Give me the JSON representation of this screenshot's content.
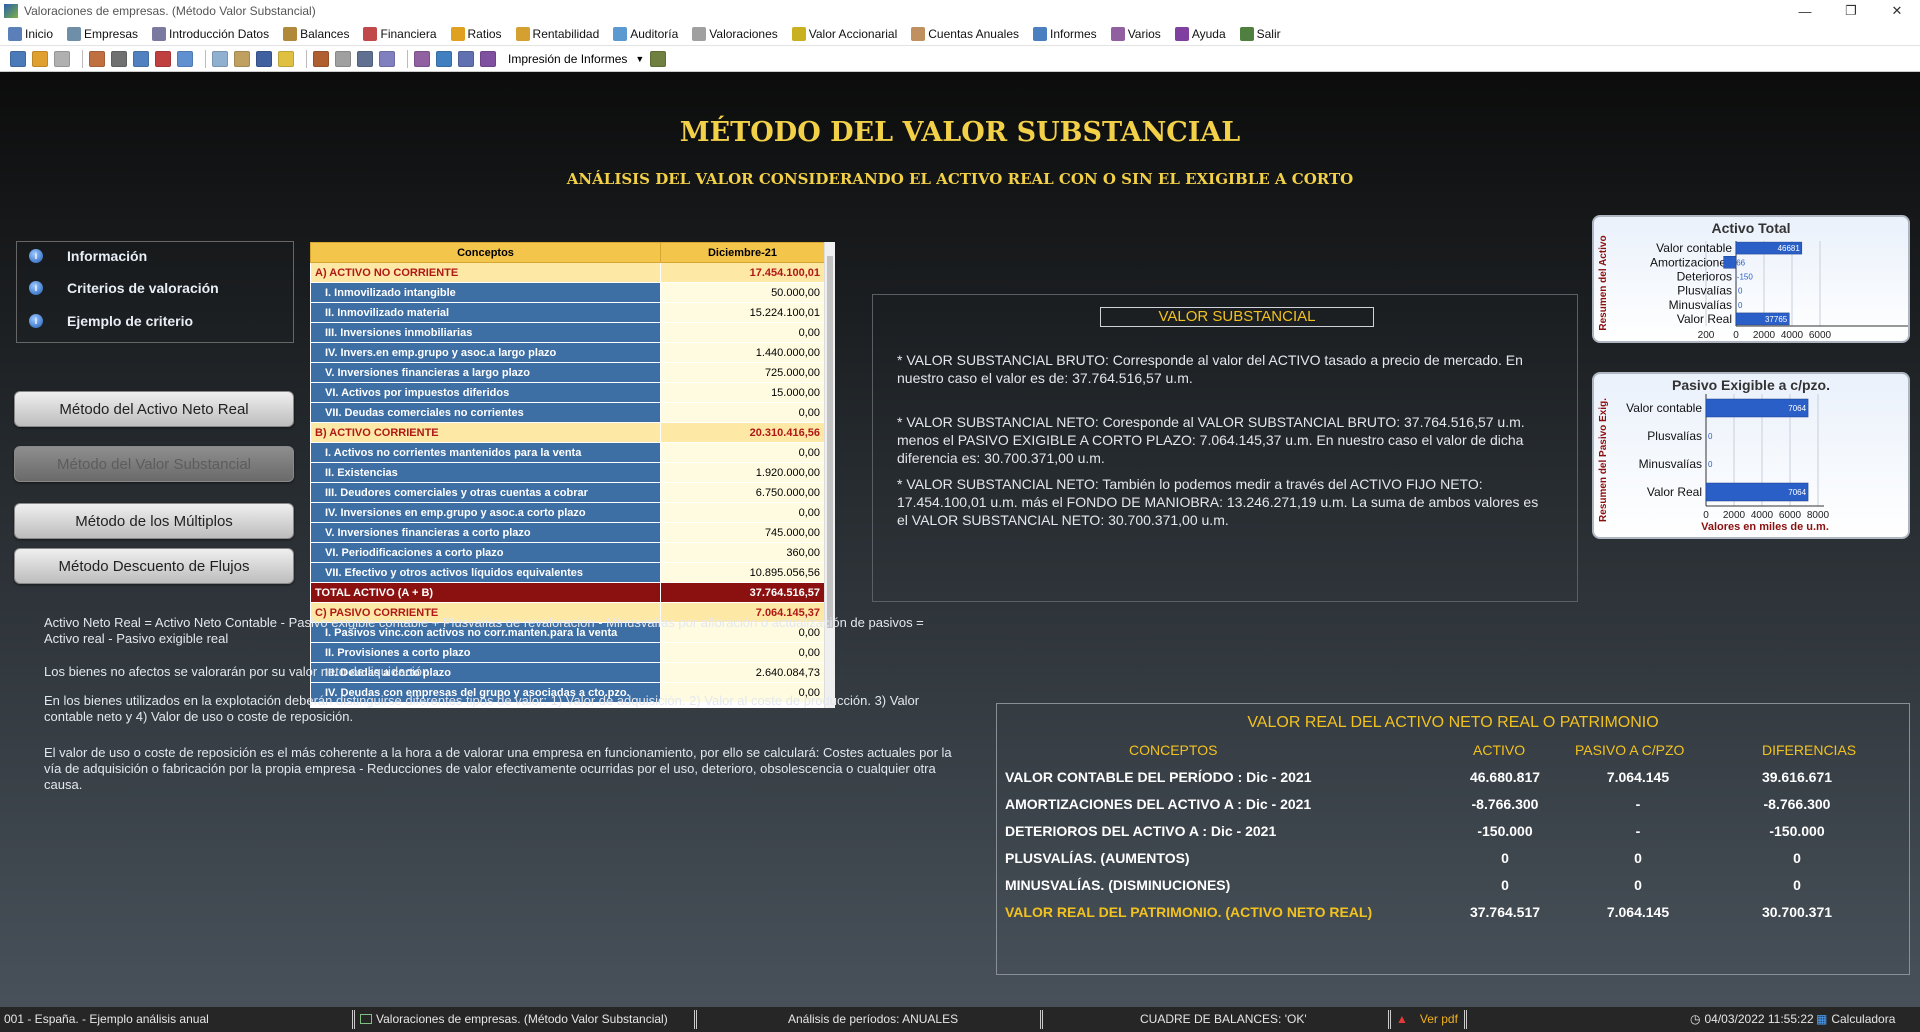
{
  "window": {
    "title": "Valoraciones de empresas. (Método Valor Substancial)"
  },
  "menu": [
    "Inicio",
    "Empresas",
    "Introducción Datos",
    "Balances",
    "Financiera",
    "Ratios",
    "Rentabilidad",
    "Auditoría",
    "Valoraciones",
    "Valor Accionarial",
    "Cuentas Anuales",
    "Informes",
    "Varios",
    "Ayuda",
    "Salir"
  ],
  "toolbar": {
    "dropdown_label": "Impresión de Informes"
  },
  "page": {
    "title": "MÉTODO DEL VALOR SUBSTANCIAL",
    "subtitle": "ANÁLISIS DEL VALOR CONSIDERANDO EL ACTIVO REAL CON O SIN EL EXIGIBLE A CORTO"
  },
  "info": [
    "Información",
    "Criterios de valoración",
    "Ejemplo de criterio"
  ],
  "methods": [
    "Método del Activo Neto Real",
    "Método del Valor Substancial",
    "Método de los Múltiplos",
    "Método Descuento de Flujos"
  ],
  "balance": {
    "headers": [
      "Conceptos",
      "Diciembre-21"
    ],
    "rows": [
      {
        "concept": "A) ACTIVO NO CORRIENTE",
        "value": "17.454.100,01",
        "type": "sec"
      },
      {
        "concept": "I. Inmovilizado intangible",
        "value": "50.000,00",
        "type": "item"
      },
      {
        "concept": "II. Inmovilizado material",
        "value": "15.224.100,01",
        "type": "item"
      },
      {
        "concept": "III. Inversiones inmobiliarias",
        "value": "0,00",
        "type": "item"
      },
      {
        "concept": "IV. Invers.en emp.grupo y asoc.a largo plazo",
        "value": "1.440.000,00",
        "type": "item"
      },
      {
        "concept": "V. Inversiones financieras a largo plazo",
        "value": "725.000,00",
        "type": "item"
      },
      {
        "concept": "VI. Activos por impuestos diferidos",
        "value": "15.000,00",
        "type": "item"
      },
      {
        "concept": "VII. Deudas comerciales no corrientes",
        "value": "0,00",
        "type": "item"
      },
      {
        "concept": "B) ACTIVO CORRIENTE",
        "value": "20.310.416,56",
        "type": "sec"
      },
      {
        "concept": "I. Activos no corrientes mantenidos para la venta",
        "value": "0,00",
        "type": "item"
      },
      {
        "concept": "II. Existencias",
        "value": "1.920.000,00",
        "type": "item"
      },
      {
        "concept": "III. Deudores comerciales y otras cuentas a cobrar",
        "value": "6.750.000,00",
        "type": "item"
      },
      {
        "concept": "IV. Inversiones en emp.grupo y asoc.a corto plazo",
        "value": "0,00",
        "type": "item"
      },
      {
        "concept": "V. Inversiones financieras a corto plazo",
        "value": "745.000,00",
        "type": "item"
      },
      {
        "concept": "VI. Periodificaciones a corto plazo",
        "value": "360,00",
        "type": "item"
      },
      {
        "concept": "VII. Efectivo y otros activos líquidos equivalentes",
        "value": "10.895.056,56",
        "type": "item"
      },
      {
        "concept": "TOTAL ACTIVO (A + B)",
        "value": "37.764.516,57",
        "type": "tot"
      },
      {
        "concept": "C) PASIVO CORRIENTE",
        "value": "7.064.145,37",
        "type": "sec"
      },
      {
        "concept": "I. Pasivos vinc.con activos no corr.manten.para la venta",
        "value": "0,00",
        "type": "item"
      },
      {
        "concept": "II. Provisiones a corto plazo",
        "value": "0,00",
        "type": "item"
      },
      {
        "concept": "III. Deudas a corto plazo",
        "value": "2.640.084,73",
        "type": "item"
      },
      {
        "concept": "IV. Deudas con empresas del grupo y asociadas a cto.pzo.",
        "value": "0,00",
        "type": "item"
      }
    ]
  },
  "valor_substancial": {
    "title": "VALOR SUBSTANCIAL",
    "paragraphs": [
      "* VALOR SUBSTANCIAL BRUTO: Corresponde al valor del ACTIVO tasado a precio de mercado. En nuestro caso el valor es de: 37.764.516,57 u.m.",
      "* VALOR SUBSTANCIAL NETO: Coresponde al VALOR SUBSTANCIAL BRUTO: 37.764.516,57 u.m. menos el PASIVO EXIGIBLE A CORTO PLAZO: 7.064.145,37 u.m. En nuestro caso el valor de dicha diferencia es: 30.700.371,00 u.m.",
      "* VALOR SUBSTANCIAL NETO: También lo podemos medir a través del ACTIVO FIJO NETO: 17.454.100,01 u.m. más el FONDO DE MANIOBRA: 13.246.271,19 u.m. La suma de ambos valores es el VALOR SUBSTANCIAL NETO: 30.700.371,00 u.m."
    ]
  },
  "notes": [
    "Activo Neto Real = Activo Neto Contable - Pasivo exigible contable + Plusvalías de revaloración - Minusvalías por afloración o actualización de pasivos = Activo real - Pasivo exigible real",
    "Los bienes no afectos se valorarán por su valor neto de liquidación.",
    "En los bienes utilizados en la explotación deberán distinguirse diferentes tipos de valor: 1) Valor de adquisición. 2) Valor al coste de producción. 3) Valor contable neto y 4) Valor de uso o coste de reposición.",
    "El valor de uso o coste de reposición es el más coherente a la hora a de valorar una empresa en funcionamiento, por ello se calculará: Costes actuales por la vía de adquisición o fabricación por la propia empresa - Reducciones de valor efectivamente ocurridas por el uso, deterioro, obsolescencia o cualquier otra causa."
  ],
  "chart_data": [
    {
      "type": "bar",
      "orientation": "horizontal",
      "title": "Activo Total",
      "ylabel": "Resumen del Activo",
      "xlabel": "Valores en miles de u.m.",
      "categories": [
        "Valor contable",
        "Amortizaciones",
        "Deterioros",
        "Plusvalías",
        "Minusvalías",
        "Valor Real"
      ],
      "values": [
        46681,
        -8766,
        -150,
        0,
        0,
        37765
      ],
      "labels": [
        "46681",
        "-8766",
        "-150",
        "0",
        "0",
        "37765"
      ],
      "xticks": [
        "200",
        "0",
        "2000",
        "4000",
        "6000"
      ],
      "color": "#2a5fc7"
    },
    {
      "type": "bar",
      "orientation": "horizontal",
      "title": "Pasivo Exigible a c/pzo.",
      "ylabel": "Resumen del Pasivo Exig.",
      "xlabel": "Valores en miles de u.m.",
      "categories": [
        "Valor contable",
        "Plusvalías",
        "Minusvalías",
        "Valor Real"
      ],
      "values": [
        7064,
        0,
        0,
        7064
      ],
      "labels": [
        "7064",
        "0",
        "0",
        "7064"
      ],
      "xticks": [
        "0",
        "2000",
        "4000",
        "6000",
        "8000"
      ],
      "color": "#2a5fc7"
    }
  ],
  "valor_real": {
    "title": "VALOR REAL DEL ACTIVO NETO REAL O PATRIMONIO",
    "headers": [
      "CONCEPTOS",
      "ACTIVO",
      "PASIVO A C/PZO",
      "DIFERENCIAS"
    ],
    "rows": [
      [
        "VALOR CONTABLE DEL PERÍODO : Dic - 2021",
        "46.680.817",
        "7.064.145",
        "39.616.671"
      ],
      [
        "AMORTIZACIONES DEL ACTIVO A :  Dic - 2021",
        "-8.766.300",
        "-",
        "-8.766.300"
      ],
      [
        "DETERIOROS DEL ACTIVO A :  Dic - 2021",
        "-150.000",
        "-",
        "-150.000"
      ],
      [
        "PLUSVALÍAS. (AUMENTOS)",
        "0",
        "0",
        "0"
      ],
      [
        "MINUSVALÍAS. (DISMINUCIONES)",
        "0",
        "0",
        "0"
      ],
      [
        "VALOR REAL DEL PATRIMONIO. (ACTIVO NETO REAL)",
        "37.764.517",
        "7.064.145",
        "30.700.371"
      ]
    ]
  },
  "status": {
    "company": "001 - España. - Ejemplo análisis anual",
    "window": "Valoraciones de empresas. (Método Valor Substancial)",
    "periods": "Análisis de períodos: ANUALES",
    "cuadre": "CUADRE DE BALANCES:  'OK'",
    "pdf": "Ver pdf",
    "datetime": "04/03/2022 11:55:22",
    "calc": "Calculadora"
  }
}
